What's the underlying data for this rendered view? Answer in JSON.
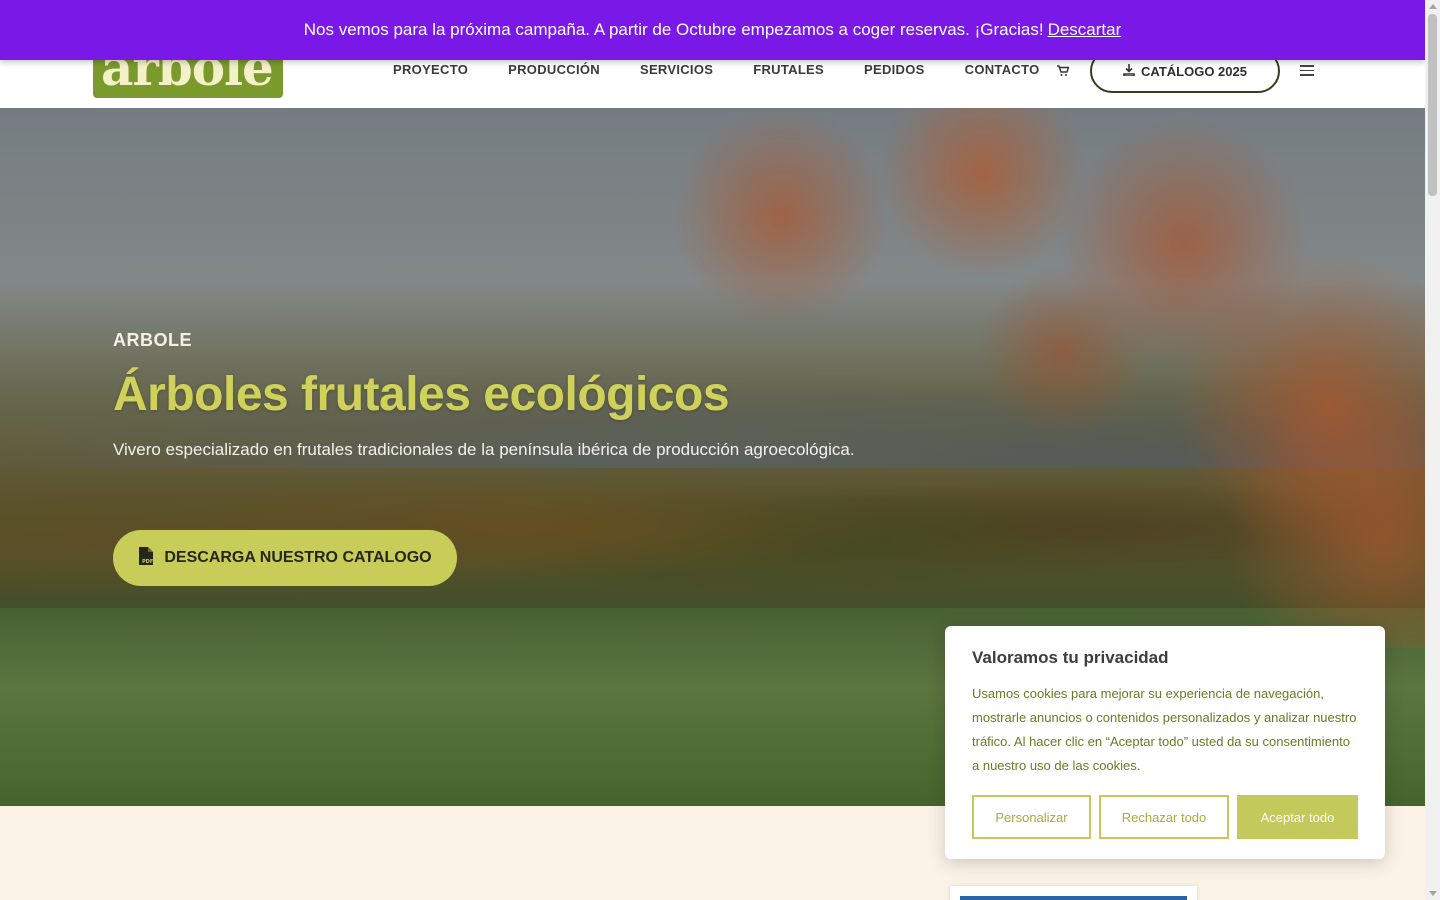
{
  "notice": {
    "message": "Nos vemos para la próxima campaña. A partir de Octubre empezamos a coger reservas. ¡Gracias!",
    "dismiss_label": "Descartar"
  },
  "header": {
    "logo_text": "arbole",
    "nav": [
      "PROYECTO",
      "PRODUCCIÓN",
      "SERVICIOS",
      "FRUTALES",
      "PEDIDOS",
      "CONTACTO"
    ],
    "cart_icon": "cart-icon",
    "catalog_button": "CATÁLOGO 2025",
    "menu_icon": "hamburger-menu-icon"
  },
  "hero": {
    "eyebrow": "ARBOLE",
    "title": "Árboles frutales ecológicos",
    "subtitle": "Vivero especializado en frutales tradicionales de la península ibérica de producción agroecológica.",
    "cta_label": "DESCARGA NUESTRO CATALOGO",
    "cta_icon": "pdf-file-icon"
  },
  "cookie": {
    "title": "Valoramos tu privacidad",
    "text": "Usamos cookies para mejorar su experiencia de navegación, mostrarle anuncios o contenidos personalizados y analizar nuestro tráfico. Al hacer clic en “Aceptar todo” usted da su consentimiento a nuestro uso de las cookies.",
    "customize_label": "Personalizar",
    "reject_label": "Rechazar todo",
    "accept_label": "Aceptar todo"
  },
  "colors": {
    "notice_bg": "#7a18e8",
    "accent": "#c8cd5a",
    "hero_title": "#cfd25a",
    "cookie_text": "#6d7a1e"
  }
}
